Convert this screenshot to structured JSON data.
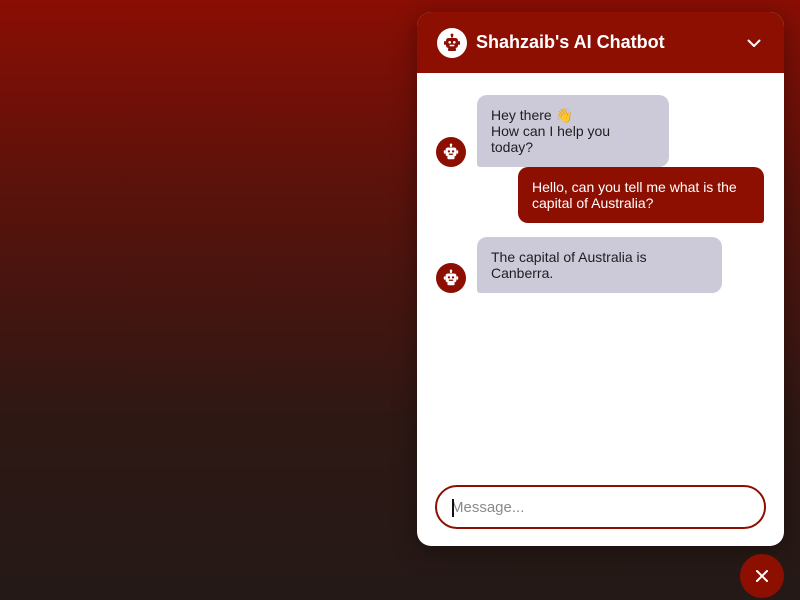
{
  "header": {
    "title": "Shahzaib's AI Chatbot",
    "avatar_icon": "robot-icon",
    "collapse_icon": "chevron-down-icon"
  },
  "messages": [
    {
      "sender": "bot",
      "text": "Hey there 👋\nHow can I help you today?"
    },
    {
      "sender": "user",
      "text": "Hello, can you tell me what is the capital of Australia?"
    },
    {
      "sender": "bot",
      "text": "The capital of Australia is Canberra."
    }
  ],
  "composer": {
    "placeholder": "Message...",
    "value": ""
  },
  "toggle_button": {
    "icon": "close-icon"
  },
  "colors": {
    "accent": "#8d0f02",
    "bot_bubble": "#ccc9d9",
    "background_top": "#8a0e04",
    "background_bottom": "#241917"
  }
}
